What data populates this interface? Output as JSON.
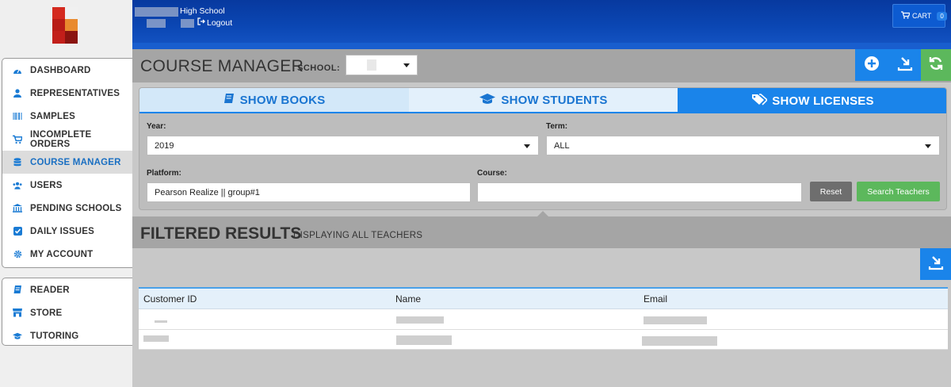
{
  "header": {
    "school_name": "High School",
    "logout_label": "Logout",
    "cart_label": "CART",
    "cart_count": "0"
  },
  "sidebar": {
    "main_items": [
      {
        "label": "DASHBOARD",
        "icon": "dashboard-icon"
      },
      {
        "label": "REPRESENTATIVES",
        "icon": "user-icon"
      },
      {
        "label": "SAMPLES",
        "icon": "barcode-icon"
      },
      {
        "label": "INCOMPLETE ORDERS",
        "icon": "cart-icon"
      },
      {
        "label": "COURSE MANAGER",
        "icon": "database-icon",
        "active": true
      },
      {
        "label": "USERS",
        "icon": "users-icon"
      },
      {
        "label": "PENDING SCHOOLS",
        "icon": "institution-icon"
      },
      {
        "label": "DAILY ISSUES",
        "icon": "check-square-icon"
      },
      {
        "label": "MY ACCOUNT",
        "icon": "gear-icon"
      }
    ],
    "secondary_items": [
      {
        "label": "READER",
        "icon": "book-icon"
      },
      {
        "label": "STORE",
        "icon": "store-icon"
      },
      {
        "label": "TUTORING",
        "icon": "graduation-cap-icon"
      }
    ]
  },
  "course_manager": {
    "title": "COURSE MANAGER",
    "school_label": "SCHOOL:",
    "school_value": ""
  },
  "tabs": [
    {
      "label": "SHOW BOOKS",
      "icon": "book-icon"
    },
    {
      "label": "SHOW STUDENTS",
      "icon": "graduation-cap-icon"
    },
    {
      "label": "SHOW LICENSES",
      "icon": "tags-icon",
      "active": true
    }
  ],
  "filters": {
    "year_label": "Year:",
    "year_value": "2019",
    "term_label": "Term:",
    "term_value": "ALL",
    "platform_label": "Platform:",
    "platform_value": "Pearson Realize || group#1",
    "course_label": "Course:",
    "course_value": "",
    "reset_label": "Reset",
    "search_label": "Search Teachers"
  },
  "results": {
    "title": "FILTERED RESULTS",
    "subtitle": "DISPLAYING ALL TEACHERS",
    "columns": [
      "Customer ID",
      "Name",
      "Email"
    ],
    "rows": [
      {
        "customer_id": "",
        "name": "",
        "email": ""
      },
      {
        "customer_id": "",
        "name": "",
        "email": ""
      }
    ]
  },
  "colors": {
    "accent": "#1a84ea",
    "success": "#5cb85c",
    "header": "#0b47b4"
  }
}
